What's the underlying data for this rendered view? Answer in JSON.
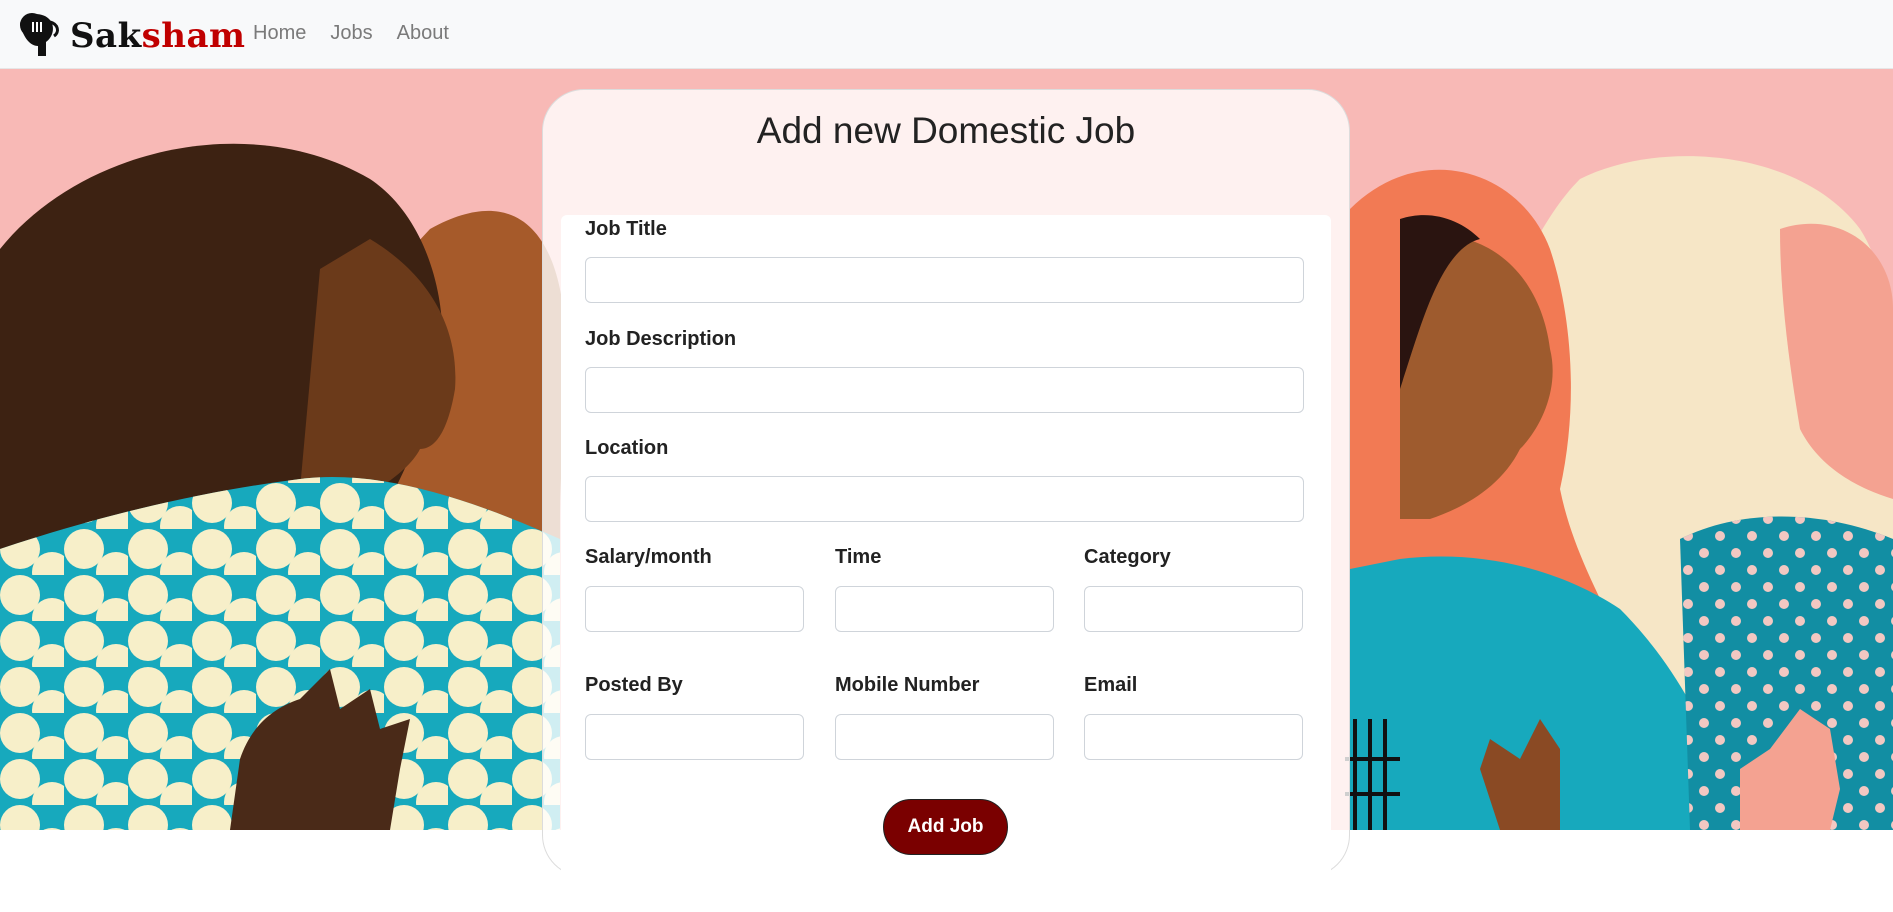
{
  "navbar": {
    "brand": {
      "part1": "Sak",
      "part2": "sham"
    },
    "links": [
      "Home",
      "Jobs",
      "About"
    ]
  },
  "form": {
    "title": "Add new Domestic Job",
    "fields": {
      "job_title": {
        "label": "Job Title",
        "value": ""
      },
      "job_description": {
        "label": "Job Description",
        "value": ""
      },
      "location": {
        "label": "Location",
        "value": ""
      },
      "salary": {
        "label": "Salary/month",
        "value": ""
      },
      "time": {
        "label": "Time",
        "value": ""
      },
      "category": {
        "label": "Category",
        "value": ""
      },
      "posted_by": {
        "label": "Posted By",
        "value": ""
      },
      "mobile": {
        "label": "Mobile Number",
        "value": ""
      },
      "email": {
        "label": "Email",
        "value": ""
      }
    },
    "submit_label": "Add Job"
  },
  "colors": {
    "brand_red": "#c00000",
    "button_bg": "#7a0000",
    "hero_pink": "#f8b9b6",
    "teal": "#17a9bd"
  },
  "icons": [
    "woman-silhouette-logo"
  ]
}
